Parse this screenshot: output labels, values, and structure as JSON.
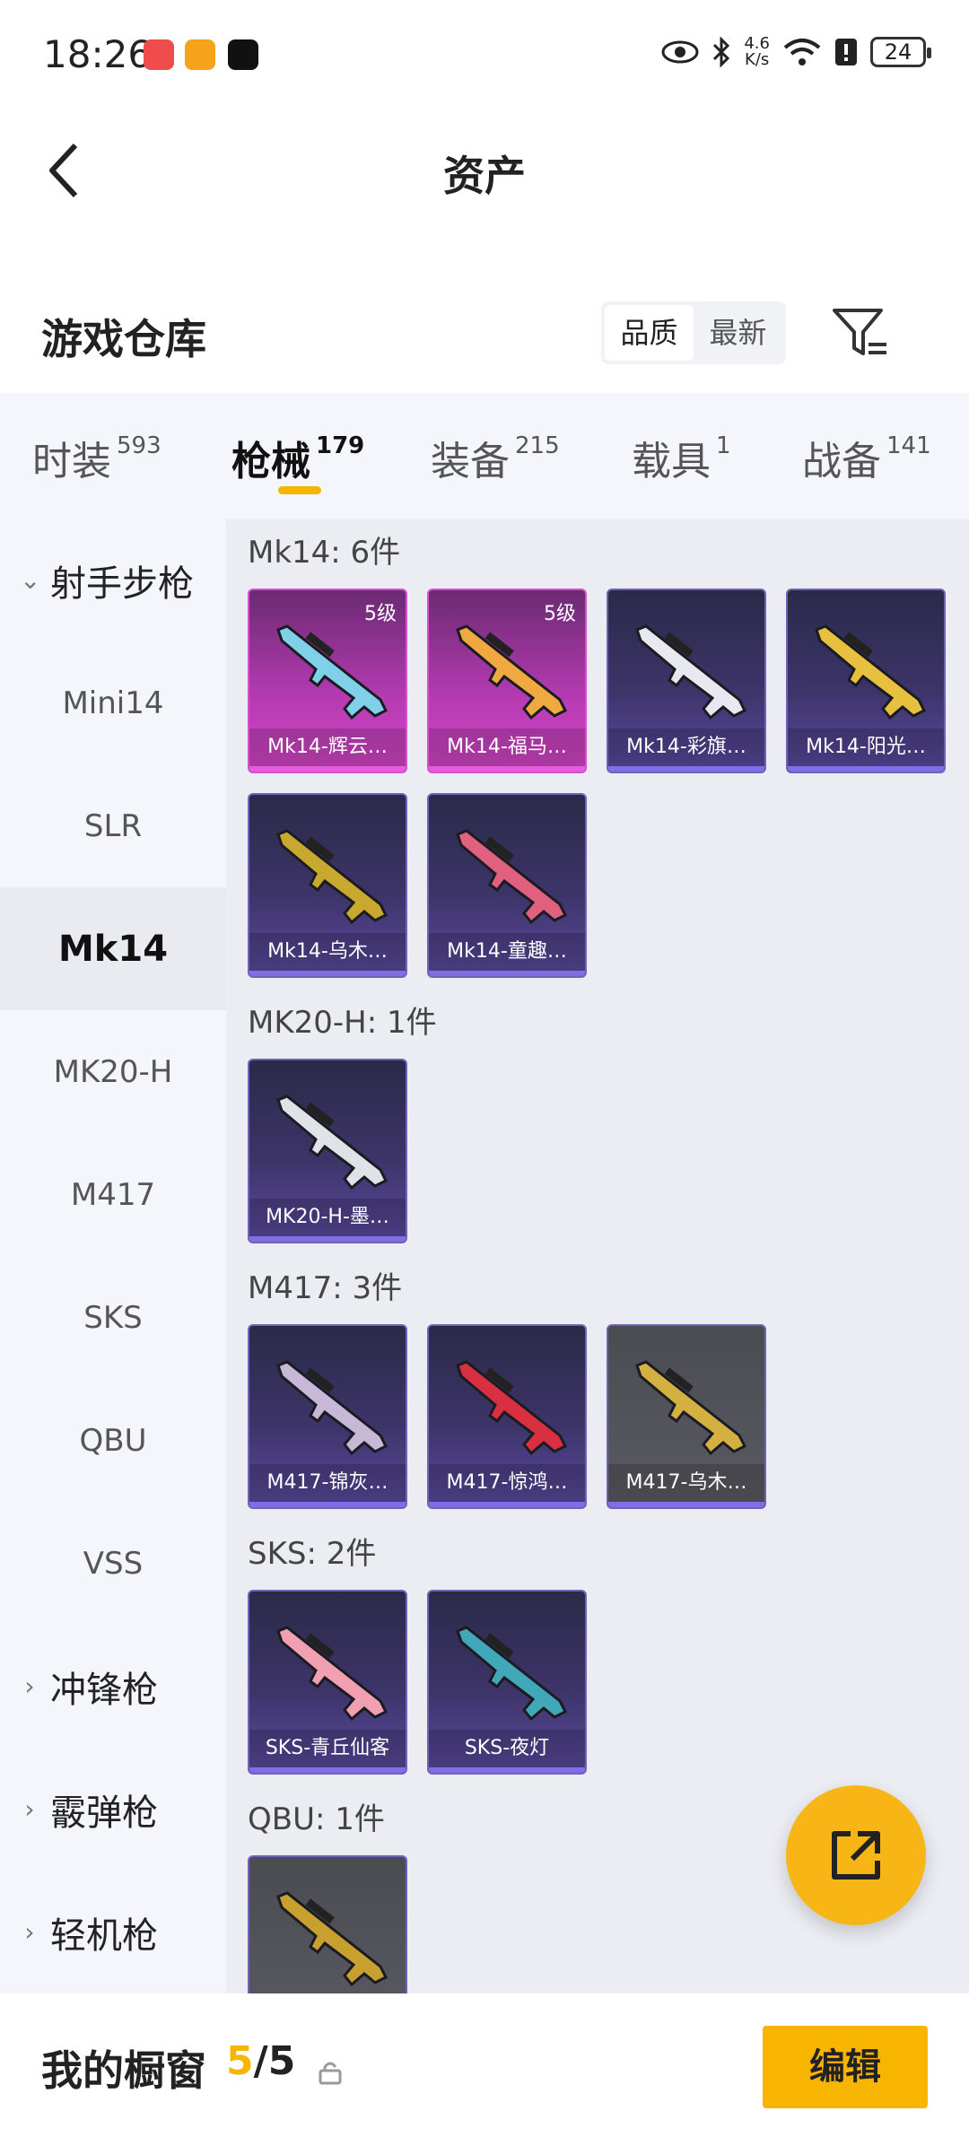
{
  "status_bar": {
    "time": "18:26",
    "net_speed_value": "4.6",
    "net_speed_unit": "K/s",
    "battery": "24",
    "app_icons": [
      "red-app-icon",
      "game-controller-icon",
      "tiktok-icon"
    ],
    "system_icons": [
      "eye-icon",
      "bluetooth-icon",
      "wifi-icon",
      "alert-icon"
    ]
  },
  "nav": {
    "title": "资产"
  },
  "section": {
    "title": "游戏仓库",
    "sort_options": [
      "品质",
      "最新"
    ],
    "active_sort": "品质"
  },
  "tabs": [
    {
      "label": "时装",
      "count": "593"
    },
    {
      "label": "枪械",
      "count": "179"
    },
    {
      "label": "装备",
      "count": "215"
    },
    {
      "label": "载具",
      "count": "1"
    },
    {
      "label": "战备",
      "count": "141"
    }
  ],
  "active_tab": "枪械",
  "sidebar": {
    "items": [
      {
        "label": "射手步枪",
        "type": "group",
        "expanded": true
      },
      {
        "label": "Mini14",
        "type": "item"
      },
      {
        "label": "SLR",
        "type": "item"
      },
      {
        "label": "Mk14",
        "type": "item",
        "active": true
      },
      {
        "label": "MK20-H",
        "type": "item"
      },
      {
        "label": "M417",
        "type": "item"
      },
      {
        "label": "SKS",
        "type": "item"
      },
      {
        "label": "QBU",
        "type": "item"
      },
      {
        "label": "VSS",
        "type": "item"
      },
      {
        "label": "冲锋枪",
        "type": "group",
        "expanded": false
      },
      {
        "label": "霰弹枪",
        "type": "group",
        "expanded": false
      },
      {
        "label": "轻机枪",
        "type": "group",
        "expanded": false
      }
    ]
  },
  "groups": [
    {
      "label": "Mk14: 6件",
      "items": [
        {
          "name": "Mk14-辉云…",
          "level": "5级",
          "rarity": "pink",
          "gun_color": "#7fd0e8"
        },
        {
          "name": "Mk14-福马…",
          "level": "5级",
          "rarity": "pink",
          "gun_color": "#f0a840"
        },
        {
          "name": "Mk14-彩旗…",
          "level": "",
          "rarity": "purple",
          "gun_color": "#e8e8f0"
        },
        {
          "name": "Mk14-阳光…",
          "level": "",
          "rarity": "purple",
          "gun_color": "#e8c040"
        },
        {
          "name": "Mk14-乌木…",
          "level": "",
          "rarity": "purple",
          "gun_color": "#c9a830"
        },
        {
          "name": "Mk14-童趣…",
          "level": "",
          "rarity": "purple",
          "gun_color": "#e06080"
        }
      ]
    },
    {
      "label": "MK20-H: 1件",
      "items": [
        {
          "name": "MK20-H-墨…",
          "level": "",
          "rarity": "purple",
          "gun_color": "#dfe3e8"
        }
      ]
    },
    {
      "label": "M417: 3件",
      "items": [
        {
          "name": "M417-锦灰…",
          "level": "",
          "rarity": "purple",
          "gun_color": "#c8b8d8"
        },
        {
          "name": "M417-惊鸿…",
          "level": "",
          "rarity": "purple",
          "gun_color": "#d83040"
        },
        {
          "name": "M417-乌木…",
          "level": "",
          "rarity": "grey",
          "gun_color": "#d4b040"
        }
      ]
    },
    {
      "label": "SKS: 2件",
      "items": [
        {
          "name": "SKS-青丘仙客",
          "level": "",
          "rarity": "purple",
          "gun_color": "#f0a0b0"
        },
        {
          "name": "SKS-夜灯",
          "level": "",
          "rarity": "purple",
          "gun_color": "#40a8b8"
        }
      ]
    },
    {
      "label": "QBU: 1件",
      "items": [
        {
          "name": "",
          "level": "",
          "rarity": "grey",
          "gun_color": "#c8a030"
        }
      ]
    }
  ],
  "fab": {
    "icon": "external-link-icon"
  },
  "bottom": {
    "title": "我的橱窗",
    "count_current": "5",
    "count_total": "/5",
    "edit_label": "编辑"
  },
  "colors": {
    "accent": "#f7b500",
    "pink_rarity": "#d447c7",
    "purple_rarity": "#5b4aa0",
    "grey_rarity": "#5a5a62"
  }
}
